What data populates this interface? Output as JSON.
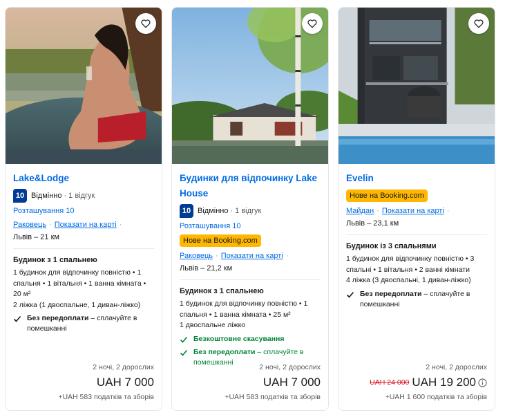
{
  "cards": [
    {
      "photo": "hot-tub-photo",
      "title": "Lake&Lodge",
      "score": "10",
      "rating_word": "Відмінно",
      "reviews": "1 відгук",
      "location_score": "Розташування 10",
      "new_badge": "",
      "district": "Раковець",
      "map_link": "Показати на карті",
      "distance": "Львів – 21 км",
      "room_title": "Будинок з 1 спальнею",
      "room_desc": "1 будинок для відпочинку повністю • 1 спальня • 1 вітальня • 1 ванна кімната • 20 м²",
      "room_beds": "2 ліжка (1 двоспальне, 1 диван-ліжко)",
      "features": [
        {
          "bold": "Без передоплати",
          "rest": " – сплачуйте в помешканні",
          "green": false
        }
      ],
      "stay": "2 ночі, 2 дорослих",
      "old_price": "",
      "price": "UAH 7 000",
      "taxes": "+UAH 583 податків та зборів"
    },
    {
      "photo": "lake-house-photo",
      "title": "Будинки для відпочинку Lake House",
      "score": "10",
      "rating_word": "Відмінно",
      "reviews": "1 відгук",
      "location_score": "Розташування 10",
      "new_badge": "Нове на Booking.com",
      "district": "Раковець",
      "map_link": "Показати на карті",
      "distance": "Львів – 21,2 км",
      "room_title": "Будинок з 1 спальнею",
      "room_desc": "1 будинок для відпочинку повністю • 1 спальня • 1 ванна кімната • 25 м²",
      "room_beds": "1 двоспальне ліжко",
      "features": [
        {
          "bold": "Безкоштовне скасування",
          "rest": "",
          "green": true
        },
        {
          "bold": "Без передоплати",
          "rest": " – сплачуйте в помешканні",
          "green": true
        }
      ],
      "stay": "2 ночі, 2 дорослих",
      "old_price": "",
      "price": "UAH 7 000",
      "taxes": "+UAH 583 податків та зборів"
    },
    {
      "photo": "modern-house-pool-photo",
      "title": "Evelin",
      "score": "",
      "rating_word": "",
      "reviews": "",
      "location_score": "",
      "new_badge": "Нове на Booking.com",
      "district": "Майдан",
      "map_link": "Показати на карті",
      "distance": "Львів – 23,1 км",
      "room_title": "Будинок із 3 спальнями",
      "room_desc": "1 будинок для відпочинку повністю • 3 спальні • 1 вітальня • 2 ванні кімнати",
      "room_beds": "4 ліжка (3 двоспальні, 1 диван-ліжко)",
      "features": [
        {
          "bold": "Без передоплати",
          "rest": " – сплачуйте в помешканні",
          "green": false
        }
      ],
      "stay": "2 ночі, 2 дорослих",
      "old_price": "UAH 24 000",
      "price": "UAH 19 200",
      "taxes": "+UAH 1 600 податків та зборів"
    }
  ],
  "colors": {
    "link": "#006ce4",
    "score_bg": "#003b95",
    "badge": "#ffb700",
    "green": "#008234",
    "strike": "#d4111e"
  },
  "icons": {
    "favorite": "heart-outline-icon",
    "check": "checkmark-icon",
    "info": "info-icon"
  }
}
